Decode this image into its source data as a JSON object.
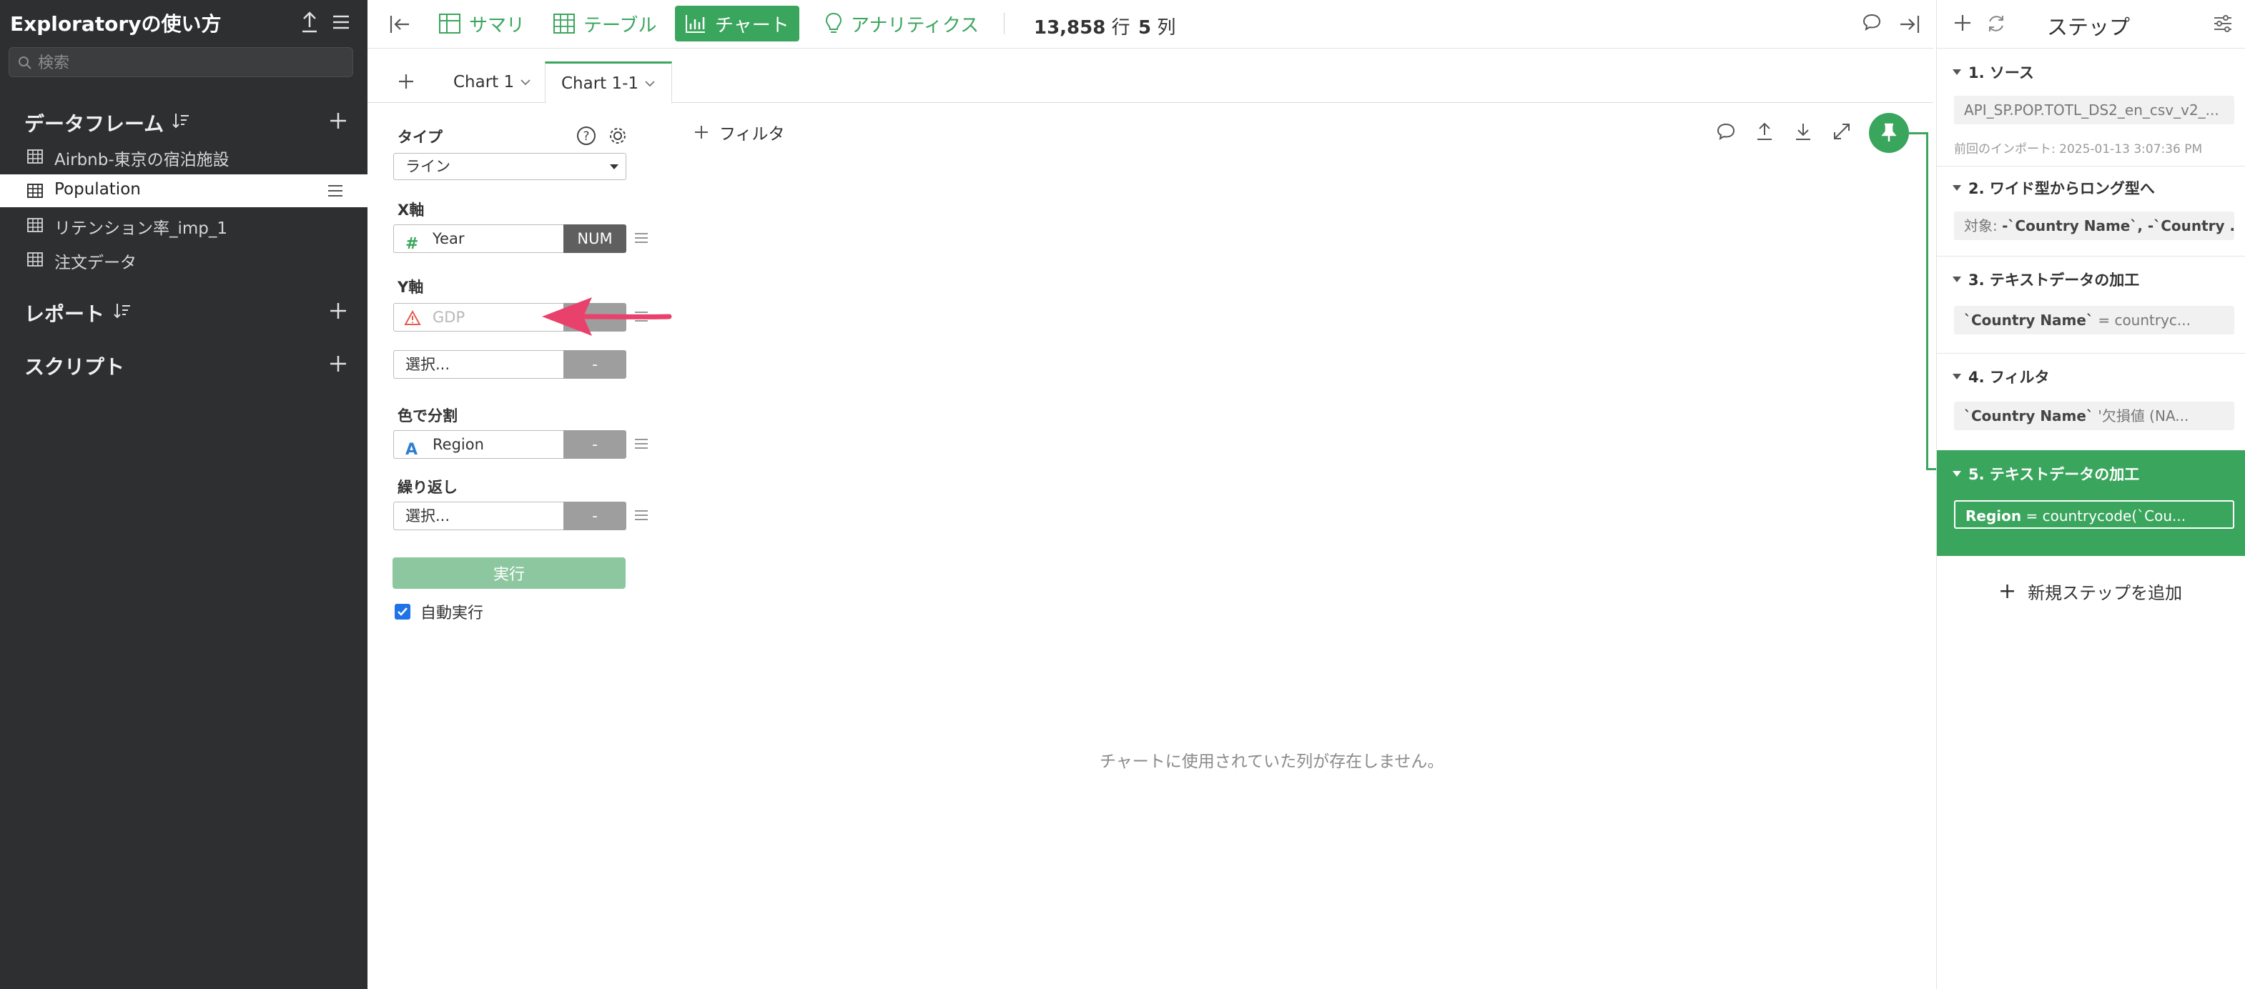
{
  "sidebar": {
    "title": "Exploratoryの使い方",
    "search_placeholder": "検索",
    "dataframes_label": "データフレーム",
    "dataframes": [
      {
        "name": "Airbnb-東京の宿泊施設"
      },
      {
        "name": "Population"
      },
      {
        "name": "リテンション率_imp_1"
      },
      {
        "name": "注文データ"
      }
    ],
    "reports_label": "レポート",
    "scripts_label": "スクリプト"
  },
  "toolbar": {
    "tabs": [
      "サマリ",
      "テーブル",
      "チャート",
      "アナリティクス"
    ],
    "active_tab": "チャート",
    "rows_value": "13,858",
    "rows_unit": "行",
    "cols_value": "5",
    "cols_unit": "列"
  },
  "chart_tabs": {
    "tabs": [
      "Chart 1",
      "Chart 1-1"
    ],
    "active": "Chart 1-1"
  },
  "config": {
    "type_label": "タイプ",
    "type_value": "ライン",
    "x_label": "X軸",
    "x_field": "Year",
    "x_type": "NUM",
    "y_label": "Y軸",
    "y_field": "GDP",
    "y_placeholder": "選択...",
    "y_type": "-",
    "color_label": "色で分割",
    "color_field": "Region",
    "color_type": "-",
    "repeat_label": "繰り返し",
    "repeat_placeholder": "選択...",
    "repeat_type": "-",
    "run_label": "実行",
    "auto_run_label": "自動実行"
  },
  "chart_area": {
    "filter_label": "フィルタ",
    "empty_message": "チャートに使用されていた列が存在しません。"
  },
  "steps": {
    "title": "ステップ",
    "items": [
      {
        "title": "1. ソース",
        "value": "API_SP.POP.TOTL_DS2_en_csv_v2_...",
        "sub": "前回のインポート: 2025-01-13 3:07:36 PM"
      },
      {
        "title": "2. ワイド型からロング型へ",
        "prefix": "対象: ",
        "bold": "-`Country Name`, -`Country ..."
      },
      {
        "title": "3. テキストデータの加工",
        "bold": "`Country Name`",
        "rest": " = countryc..."
      },
      {
        "title": "4. フィルタ",
        "bold": "`Country Name`",
        "rest": " '欠損値 (NA..."
      },
      {
        "title": "5. テキストデータの加工",
        "bold": "Region",
        "rest": " = countrycode(`Cou..."
      }
    ],
    "add_label": "新規ステップを追加"
  },
  "colors": {
    "accent": "#3aa55d",
    "sidebar_bg": "#2d2f30",
    "annotation_arrow": "#e8426c"
  }
}
